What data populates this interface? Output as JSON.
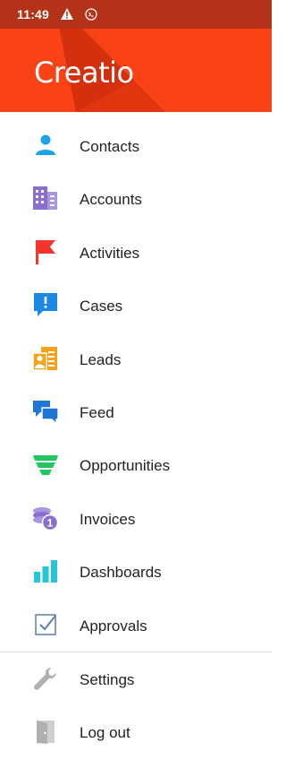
{
  "status_bar": {
    "time": "11:49"
  },
  "header": {
    "logo_text": "Creatio",
    "color": "#f94216"
  },
  "menu": {
    "items": [
      {
        "label": "Contacts",
        "icon": "person-icon",
        "color": "#1aa3e8"
      },
      {
        "label": "Accounts",
        "icon": "buildings-icon",
        "color": "#8a6fd1"
      },
      {
        "label": "Activities",
        "icon": "flag-icon",
        "color": "#f2362e"
      },
      {
        "label": "Cases",
        "icon": "exclamation-bubble-icon",
        "color": "#1e88e5"
      },
      {
        "label": "Leads",
        "icon": "lead-card-icon",
        "color": "#f7a21b"
      },
      {
        "label": "Feed",
        "icon": "chat-bubbles-icon",
        "color": "#1e76d8"
      },
      {
        "label": "Opportunities",
        "icon": "funnel-icon",
        "color": "#22c55e"
      },
      {
        "label": "Invoices",
        "icon": "coins-icon",
        "color": "#8a6fd1"
      },
      {
        "label": "Dashboards",
        "icon": "bar-chart-icon",
        "color": "#26c6da"
      },
      {
        "label": "Approvals",
        "icon": "checkbox-icon",
        "color": "#5b7fa8"
      }
    ],
    "footer_items": [
      {
        "label": "Settings",
        "icon": "wrench-icon",
        "color": "#b0b0b0"
      },
      {
        "label": "Log out",
        "icon": "door-icon",
        "color": "#b0b0b0"
      }
    ]
  }
}
